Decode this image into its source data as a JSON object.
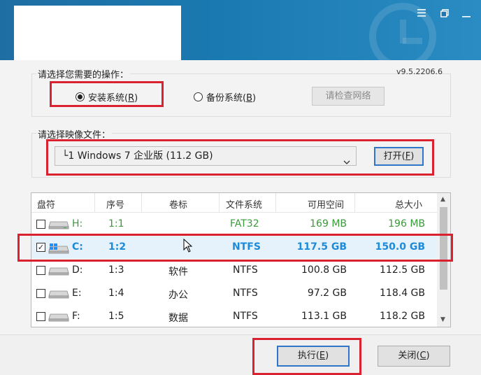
{
  "window": {
    "minimize_label": "—",
    "restore_label": "❐"
  },
  "version": "v9.5.2206.6",
  "operation": {
    "label": "请选择您需要的操作：",
    "install": {
      "text": "安装系统(",
      "key": "R",
      "tail": ")"
    },
    "backup": {
      "text": "备份系统(",
      "key": "B",
      "tail": ")"
    },
    "check_network": "请检查网络"
  },
  "image": {
    "label": "请选择映像文件：",
    "selected": "└1 Windows 7 企业版 (11.2 GB)",
    "open_button": {
      "text": "打开(",
      "key": "F",
      "tail": ")"
    }
  },
  "table": {
    "columns": [
      "盘符",
      "序号",
      "卷标",
      "文件系统",
      "可用空间",
      "总大小"
    ],
    "rows": [
      {
        "checked": false,
        "drive": "H:",
        "index": "1:1",
        "label": "",
        "fs": "FAT32",
        "free": "169 MB",
        "total": "196 MB",
        "style": "green",
        "icon": "usb-drive-icon"
      },
      {
        "checked": true,
        "drive": "C:",
        "index": "1:2",
        "label": "",
        "fs": "NTFS",
        "free": "117.5 GB",
        "total": "150.0 GB",
        "style": "blue",
        "icon": "windows-drive-icon"
      },
      {
        "checked": false,
        "drive": "D:",
        "index": "1:3",
        "label": "软件",
        "fs": "NTFS",
        "free": "100.8 GB",
        "total": "112.5 GB",
        "style": "black",
        "icon": "hard-drive-icon"
      },
      {
        "checked": false,
        "drive": "E:",
        "index": "1:4",
        "label": "办公",
        "fs": "NTFS",
        "free": "97.2 GB",
        "total": "118.4 GB",
        "style": "black",
        "icon": "hard-drive-icon"
      },
      {
        "checked": false,
        "drive": "F:",
        "index": "1:5",
        "label": "数据",
        "fs": "NTFS",
        "free": "113.1 GB",
        "total": "118.2 GB",
        "style": "black",
        "icon": "hard-drive-icon"
      }
    ]
  },
  "footer": {
    "execute": {
      "text": "执行(",
      "key": "E",
      "tail": ")"
    },
    "close": {
      "text": "关闭(",
      "key": "C",
      "tail": ")"
    }
  },
  "colors": {
    "highlight_red": "#d9212f",
    "selected_row": "#e5f1fb",
    "green_text": "#3a9a3a",
    "blue_text": "#1d8bd8"
  }
}
